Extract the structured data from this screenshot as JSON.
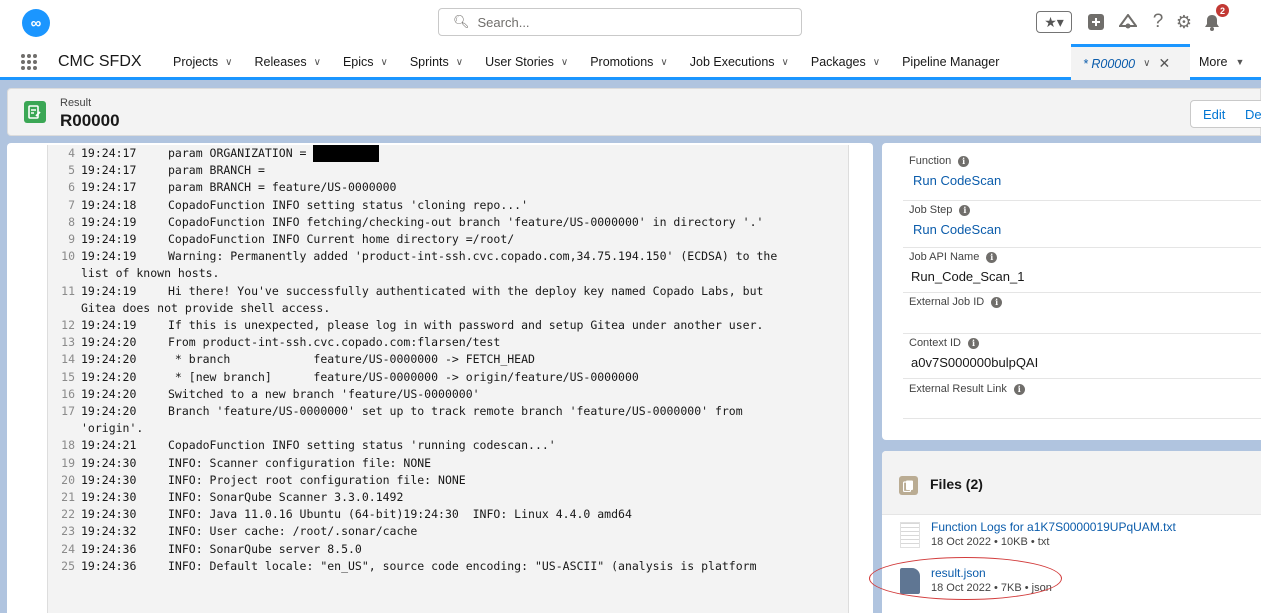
{
  "header": {
    "search_placeholder": "Search...",
    "notification_count": "2",
    "logo_glyph": "∞"
  },
  "nav": {
    "app_name": "CMC SFDX",
    "items": [
      {
        "label": "Projects"
      },
      {
        "label": "Releases"
      },
      {
        "label": "Epics"
      },
      {
        "label": "Sprints"
      },
      {
        "label": "User Stories"
      },
      {
        "label": "Promotions"
      },
      {
        "label": "Job Executions"
      },
      {
        "label": "Packages"
      }
    ],
    "pipeline_manager": "Pipeline Manager",
    "active_tab": "* R00000",
    "more": "More"
  },
  "record": {
    "type": "Result",
    "name": "R00000",
    "edit_label": "Edit",
    "delete_label": "Delete"
  },
  "log": {
    "lines": [
      {
        "n": "4",
        "time": "19:24:17",
        "text": "param ORGANIZATION = ",
        "redacted": true
      },
      {
        "n": "5",
        "time": "19:24:17",
        "text": "param BRANCH ="
      },
      {
        "n": "6",
        "time": "19:24:17",
        "text": "param BRANCH = feature/US-0000000"
      },
      {
        "n": "7",
        "time": "19:24:18",
        "text": "CopadoFunction INFO setting status 'cloning repo...'"
      },
      {
        "n": "8",
        "time": "19:24:19",
        "text": "CopadoFunction INFO fetching/checking-out branch 'feature/US-0000000' in directory '.'"
      },
      {
        "n": "9",
        "time": "19:24:19",
        "text": "CopadoFunction INFO Current home directory =/root/"
      },
      {
        "n": "10",
        "time": "19:24:19",
        "text": "Warning: Permanently added 'product-int-ssh.cvc.copado.com,34.75.194.150' (ECDSA) to the",
        "cont": "list of known hosts."
      },
      {
        "n": "11",
        "time": "19:24:19",
        "text": "Hi there! You've successfully authenticated with the deploy key named Copado Labs, but",
        "cont": "Gitea does not provide shell access."
      },
      {
        "n": "12",
        "time": "19:24:19",
        "text": "If this is unexpected, please log in with password and setup Gitea under another user."
      },
      {
        "n": "13",
        "time": "19:24:20",
        "text": "From product-int-ssh.cvc.copado.com:flarsen/test"
      },
      {
        "n": "14",
        "time": "19:24:20",
        "text": " * branch            feature/US-0000000 -> FETCH_HEAD"
      },
      {
        "n": "15",
        "time": "19:24:20",
        "text": " * [new branch]      feature/US-0000000 -> origin/feature/US-0000000"
      },
      {
        "n": "16",
        "time": "19:24:20",
        "text": "Switched to a new branch 'feature/US-0000000'"
      },
      {
        "n": "17",
        "time": "19:24:20",
        "text": "Branch 'feature/US-0000000' set up to track remote branch 'feature/US-0000000' from",
        "cont": "'origin'."
      },
      {
        "n": "18",
        "time": "19:24:21",
        "text": "CopadoFunction INFO setting status 'running codescan...'"
      },
      {
        "n": "19",
        "time": "19:24:30",
        "text": "INFO: Scanner configuration file: NONE"
      },
      {
        "n": "20",
        "time": "19:24:30",
        "text": "INFO: Project root configuration file: NONE"
      },
      {
        "n": "21",
        "time": "19:24:30",
        "text": "INFO: SonarQube Scanner 3.3.0.1492"
      },
      {
        "n": "22",
        "time": "19:24:30",
        "text": "INFO: Java 11.0.16 Ubuntu (64-bit)19:24:30  INFO: Linux 4.4.0 amd64"
      },
      {
        "n": "23",
        "time": "19:24:32",
        "text": "INFO: User cache: /root/.sonar/cache"
      },
      {
        "n": "24",
        "time": "19:24:36",
        "text": "INFO: SonarQube server 8.5.0"
      },
      {
        "n": "25",
        "time": "19:24:36",
        "text": "INFO: Default locale: \"en_US\", source code encoding: \"US-ASCII\" (analysis is platform"
      }
    ]
  },
  "details": {
    "function_label": "Function",
    "function_value": "Run CodeScan",
    "job_step_label": "Job Step",
    "job_step_value": "Run CodeScan",
    "job_api_name_label": "Job API Name",
    "job_api_name_value": "Run_Code_Scan_1",
    "external_job_id_label": "External Job ID",
    "context_id_label": "Context ID",
    "context_id_value": "a0v7S000000bulpQAI",
    "external_result_link_label": "External Result Link"
  },
  "files": {
    "title": "Files (2)",
    "items": [
      {
        "name": "Function Logs for a1K7S0000019UPqUAM.txt",
        "meta": "18 Oct 2022 • 10KB • txt"
      },
      {
        "name": "result.json",
        "meta": "18 Oct 2022 • 7KB • json"
      }
    ]
  },
  "colors": {
    "brand": "#1b96ff",
    "link": "#0b5cab",
    "record_icon": "#3ba755",
    "badge": "#c23934",
    "annotation": "#d23c3c"
  },
  "icons": [
    "logo-icon",
    "search-icon",
    "favorites-icon",
    "add-icon",
    "trailhead-icon",
    "help-icon",
    "setup-icon",
    "bell-icon",
    "app-launcher-icon",
    "result-record-icon",
    "info-icon",
    "files-icon",
    "txt-file-icon",
    "json-file-icon"
  ]
}
